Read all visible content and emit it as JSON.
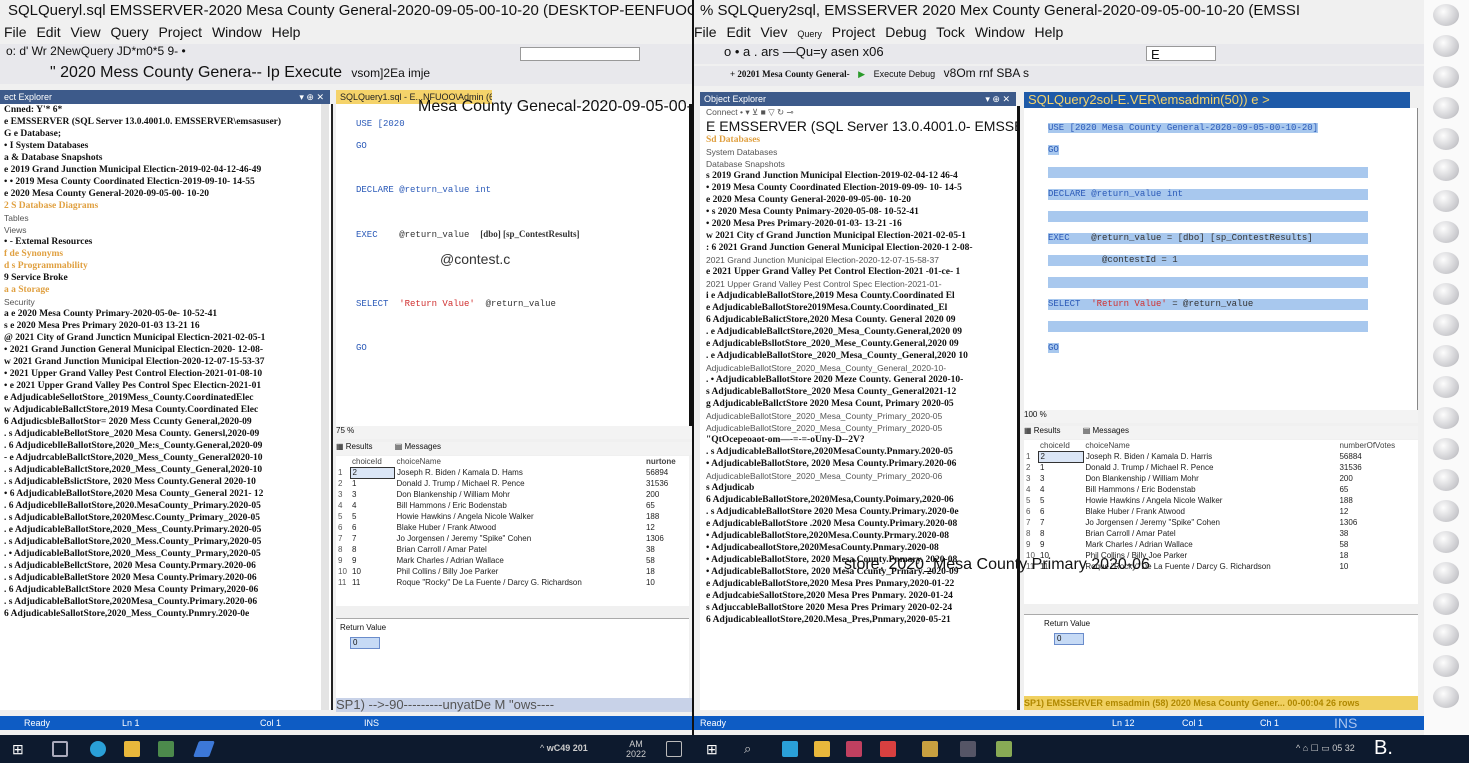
{
  "left": {
    "title": "SQLQueryl.sql EMSSERVER-2020 Mesa County General-2020-09-05-00-10-20 (DESKTOP-EENFUOO\\Admin",
    "menu": [
      "File",
      "Edit",
      "View",
      "Query",
      "Project",
      "Window",
      "Help"
    ],
    "toolbar1": "o: d' Wr 2NewQuery JD*m0*5 9- •",
    "toolbar2": "\" 2020 Mess County Genera-- Ip Execute",
    "toolbar2b": "vsom]2Ea imje",
    "oe_header": "ect Explorer",
    "connect": "Cnned: Y'*",
    "connect_b": "6*",
    "tree": [
      "e EMSSERVER (SQL Server 13.0.4001.0. EMSSERVER\\emsasuser)",
      "G e Database;",
      "• I System Databases",
      "a & Database Snapshots",
      "e 2019 Grand Junction Municipal Electicn-2019-02-04-12-46-49",
      "• • 2019 Mesa County Coordinated Electicn-2019-09-10- 14-55",
      "e 2020 Mesa County General-2020-09-05-00- 10-20",
      "2 S Database Diagrams",
      "Tables",
      "Views",
      "• - Extemal Resources",
      "f de Synonyms",
      "d s Programmability",
      "9 Service Broke",
      "a a Storage",
      "Security",
      "a e 2020 Mesa County Primary-2020-05-0e- 10-52-41",
      "s e 2020 Mesa Pres Primary 2020-01-03 13-21 16",
      "@ 2021 City of Grand Juncticn Municipal Electicn-2021-02-05-1",
      "• 2021 Grand Junction General Municipal Electicn-2020- 12-08-",
      "w 2021 Grand Junction Municipal Election-2020-12-07-15-53-37",
      "• 2021 Upper Grand Valley Pest Control Election-2021-01-08-10",
      "• e 2021 Upper Grand Valley Pes Control Spec Electicn-2021-01",
      "e AdjudicableSellotStore_2019Mess_County.CoordinatedElec",
      "w AdjudicableBallctStore,2019 Mesa County.Coordinated Elec",
      "6 AdjudicsbleBallotStor= 2020 Mess Ccunty General,2020-09",
      ". s AdjudicableBellotStore_2020 Mesa County. Genersl,2020-09",
      ". 6 AdjudiceblleBallotStore,2020_Me:s_County.General,2020-09",
      "- e AdjudrcableBallctStore,2020_Mess_County_General2020-10",
      ". s AdjudicableBallctStore,2020_Mess_County_General,2020-10",
      ". s AdjudicableBslictStore, 2020 Mess County.General 2020-10",
      "• 6 AdjudicableBallotStore,2020 Mesa County_General 2021- 12",
      ". 6 AdjudiceblleBallotStore,2020.MesaCounty_Primary.2020-05",
      ". s AdjudicableBallotStore,2020Mesc.County_Primary_2020-05",
      ". e AdjudicableBallotStore,2020_Mess_County.Primary.2020-05",
      ". s AdjudicableBallotStore,2020_Mess.County_Primary,2020-05",
      ". • AdjudicableBallotStore,2020_Mess_County_Prmary,2020-05",
      ". s AdjudicableBellctStore, 2020 Mesa County.Prmary.2020-06",
      ". s AdjudicableBalletStore 2020 Mesa County.Primary.2020-06",
      ". 6 AdjudicableBallctStore 2020 Mesa County Primary,2020-06",
      ". s AdjudicableBallotStore,2020Mesa_County.Primary.2020-06",
      "6 AdjudicableSallotStore,2020_Mess_County.Pnmry.2020-0e"
    ],
    "tab": "SQLQuery1.sql - E...NFUOO\\Admin (66))*",
    "tab_overlay": "Mesa County Genecal-2020-09-05-00-10-20]",
    "code": {
      "l1": "USE [2020",
      "l2": "GO",
      "l3": "DECLARE @return_value int",
      "l4a": "EXEC",
      "l4b": "@return_value",
      "l4c": "[dbo] [sp_ContestResults]",
      "l5": "@contest.c",
      "l6a": "SELECT",
      "l6b": "'Return Value'",
      "l6c": "@return_value",
      "l7": "GO"
    },
    "zoom": "75 %",
    "results_tab": "Results",
    "messages_tab": "Messages",
    "columns": [
      "choiceId",
      "choiceName",
      "nurtone"
    ],
    "rows": [
      [
        "1",
        "2",
        "Joseph R. Biden / Kamala D. Hams",
        "56894"
      ],
      [
        "2",
        "1",
        "Donald J. Trump / Michael R. Pence",
        "31536"
      ],
      [
        "3",
        "3",
        "Don Blankenship / William Mohr",
        "200"
      ],
      [
        "4",
        "4",
        "Bill Hammons / Eric Bodenstab",
        "65"
      ],
      [
        "5",
        "5",
        "Howie Hawkins / Angela Nicole Walker",
        "188"
      ],
      [
        "6",
        "6",
        "Blake Huber / Frank Atwood",
        "12"
      ],
      [
        "7",
        "7",
        "Jo Jorgensen / Jeremy \"Spike\" Cohen",
        "1306"
      ],
      [
        "8",
        "8",
        "Brian Carroll / Amar Patel",
        "38"
      ],
      [
        "9",
        "9",
        "Mark Charles / Adrian Wallace",
        "58"
      ],
      [
        "10",
        "10",
        "Phil Collins / Billy Joe Parker",
        "18"
      ],
      [
        "11",
        "11",
        "Roque \"Rocky\" De La Fuente / Darcy G. Richardson",
        "10"
      ]
    ],
    "return_label": "Return Value",
    "return_value": "0",
    "overlay_status": "SP1) -->-90---------unyatDe M \"ows----",
    "status_ready": "Ready",
    "status_ln": "Ln 1",
    "status_col": "Col 1",
    "status_ins": "INS"
  },
  "right": {
    "title": "% SQLQuery2sql, EMSSERVER 2020 Mex County General-2020-09-05-00-10-20 (EMSSI",
    "menu": [
      "File",
      "Edit",
      "Viev",
      "Query",
      "Project",
      "Debug",
      "Tock",
      "Window",
      "Help"
    ],
    "menu_overlay": "Query",
    "toolbar1": "o • a . ars —Qu=y asen x06",
    "toolbar1b": "E",
    "toolbar2": "+ 20201 Mesa County General-",
    "toolbar2b": "Execute Debug",
    "toolbar2c": "v8Om rnf SBA s",
    "w_glyph": "w:",
    "oe_header": "Object Explorer",
    "connect": "Connect •",
    "server": "E EMSSERVER (SQL Server 13.0.4001.0- EMSSERVERVemsadmin)",
    "db_header": "Sd Databases",
    "tree": [
      "System Databases",
      "Database Snapshots",
      "s 2019 Grand Junction Municipal Election-2019-02-04-12 46-4",
      "• 2019 Mesa County Coordinated Election-2019-09-09- 10- 14-5",
      "e 2020 Mesa County General-2020-09-05-00- 10-20",
      "• s 2020 Mesa County Pnimary-2020-05-08- 10-52-41",
      "• 2020 Mesa Pres Primary-2020-01-03- 13-21 -16",
      "w 2021 City cf Grand Junction Municipal Election-2021-02-05-1",
      ": 6 2021 Grand Junction General Municipal Election-2020-1 2-08-",
      "2021 Grand Junction Municipal Election-2020-12-07-15-58-37",
      "e 2021 Upper Grand Valley Pet Control Election-2021 -01-ce- 1",
      "2021 Upper Grand Valley Pest Control Spec Election-2021-01-",
      "i e AdjudicableBallotStore,2019 Mesa County.Coordinated El",
      "e AdjudicableBallotStore2019Mesa.County.Coordinated_El",
      "6 AdjudicableBalictStore,2020 Mesa County. General 2020 09",
      ". e AdjudicableBallctStore,2020_Mesa_County.General,2020 09",
      "e AdjudicableBsllotStore_2020_Mese_County.General,2020 09",
      ". e AdjudicableBallotStore_2020_Mesa_County_General,2020 10",
      "AdjudicableBallotStore_2020_Mesa_County_General_2020-10-",
      ". • AdjudicableBallotStore 2020 Meze County. General 2020-10-",
      "s AdjudicableBallotStore_2020 Mesa County_General2021-12",
      "g AdjudicableBallctStore 2020 Mesa Count, Primary 2020-05",
      "AdjudicableBallotStore_2020_Mesa_County_Primary_2020-05",
      "AdjudicableBallotStore_2020_Mesa_County_Primary_2020-05",
      "\"QtOcepeoaot-om—-=-=-oUny-D--2V?",
      ". s AdjudicableBallotStore,2020MesaCounty.Pnmary.2020-05",
      "• AdjudicableBallotStore, 2020 Mesa County.Primary.2020-06",
      "AdjudicableBallotStore_2020_Mesa_County_Primary_2020-06",
      "s Adjudicab",
      "6 AdjudicableBallotStore,2020Mesa,County.Poimary,2020-06",
      ". s AdjudicableBallotStore 2020 Mesa County.Primary.2020-0e",
      "e AdjudicableBallotStore .2020 Mesa County.Primary.2020-08",
      "• AdjudicableBallotStore,2020Mesa.County.Prmary.2020-08",
      "• AdjudicabeallotStore,2020MesaCounty.Pnmary.2020-08",
      "• AdjudicableBallotStore, 2020 Mesa County.Pnmary. 2020-08",
      "• AdjudicableBallotStore, 2020 Mesa Ccunty_Prmary. 2020-09",
      "e AdjudicableBallotStore,2020 Mesa Pres Pnmary,2020-01-22",
      "e AdjudcabieSallotStore,2020 Mesa Pres Pnmary. 2020-01-24",
      "s AdjuccableBallotStore 2020 Mesa Pres Primary 2020-02-24",
      "6 AdjudicableallotStore,2020.Mesa_Pres,Pnmary,2020-05-21"
    ],
    "tree_overlay": "store, 2020_Mesa County Primary 2020-06",
    "tab": "SQLQuery2sol-E.VER\\emsadmin(50)) e >",
    "code": {
      "l1": "USE [2020 Mesa County General-2020-09-05-00-10-20]",
      "l2": "GO",
      "l3": "DECLARE @return_value int",
      "l4a": "EXEC",
      "l4b": "@return_value = [dbo] [sp_ContestResults]",
      "l5": "@contestId = 1",
      "l6a": "SELECT",
      "l6b": "'Return Value'",
      "l6c": "= @return_value",
      "l7": "GO"
    },
    "zoom": "100 %",
    "results_tab": "Results",
    "messages_tab": "Messages",
    "columns": [
      "choiceId",
      "choiceName",
      "numberOfVotes"
    ],
    "rows": [
      [
        "1",
        "2",
        "Joseph R. Biden / Kamala D. Harris",
        "56884"
      ],
      [
        "2",
        "1",
        "Donald J. Trump / Michael R. Pence",
        "31536"
      ],
      [
        "3",
        "3",
        "Don Blankenship / William Mohr",
        "200"
      ],
      [
        "4",
        "4",
        "Bill Hammons / Eric Bodenstab",
        "65"
      ],
      [
        "5",
        "5",
        "Howie Hawkins / Angela Nicole Walker",
        "188"
      ],
      [
        "6",
        "6",
        "Blake Huber / Frank Atwood",
        "12"
      ],
      [
        "7",
        "7",
        "Jo Jorgensen / Jeremy \"Spike\" Cohen",
        "1306"
      ],
      [
        "8",
        "8",
        "Brian Carroll / Amar Patel",
        "38"
      ],
      [
        "9",
        "9",
        "Mark Charles / Adrian Wallace",
        "58"
      ],
      [
        "10",
        "10",
        "Phil Collins / Billy Joe Parker",
        "18"
      ],
      [
        "11",
        "11",
        "Roque \"Rocky\" De La Fuente / Darcy G. Richardson",
        "10"
      ]
    ],
    "return_label": "Return Value",
    "return_value": "0",
    "status_conn": "SP1) EMSSERVER emsadmin (58) 2020 Mesa County Gener... 00-00:04 26 rows",
    "status_ready": "Ready",
    "status_ln": "Ln 12",
    "status_col": "Col 1",
    "status_ch": "Ch 1",
    "status_ins": "INS"
  },
  "taskbar": {
    "tray_left": "wC49 201",
    "clock_left_top": "AM",
    "clock_left_bottom": "2022",
    "tray_right": "05 32",
    "corner_glyph": "B."
  },
  "colors": {
    "status_blue": "#0e5cc4",
    "selection_blue": "#a8c8ee",
    "tab_yellow": "#f5d36a",
    "taskbar": "#0d1a2e"
  }
}
